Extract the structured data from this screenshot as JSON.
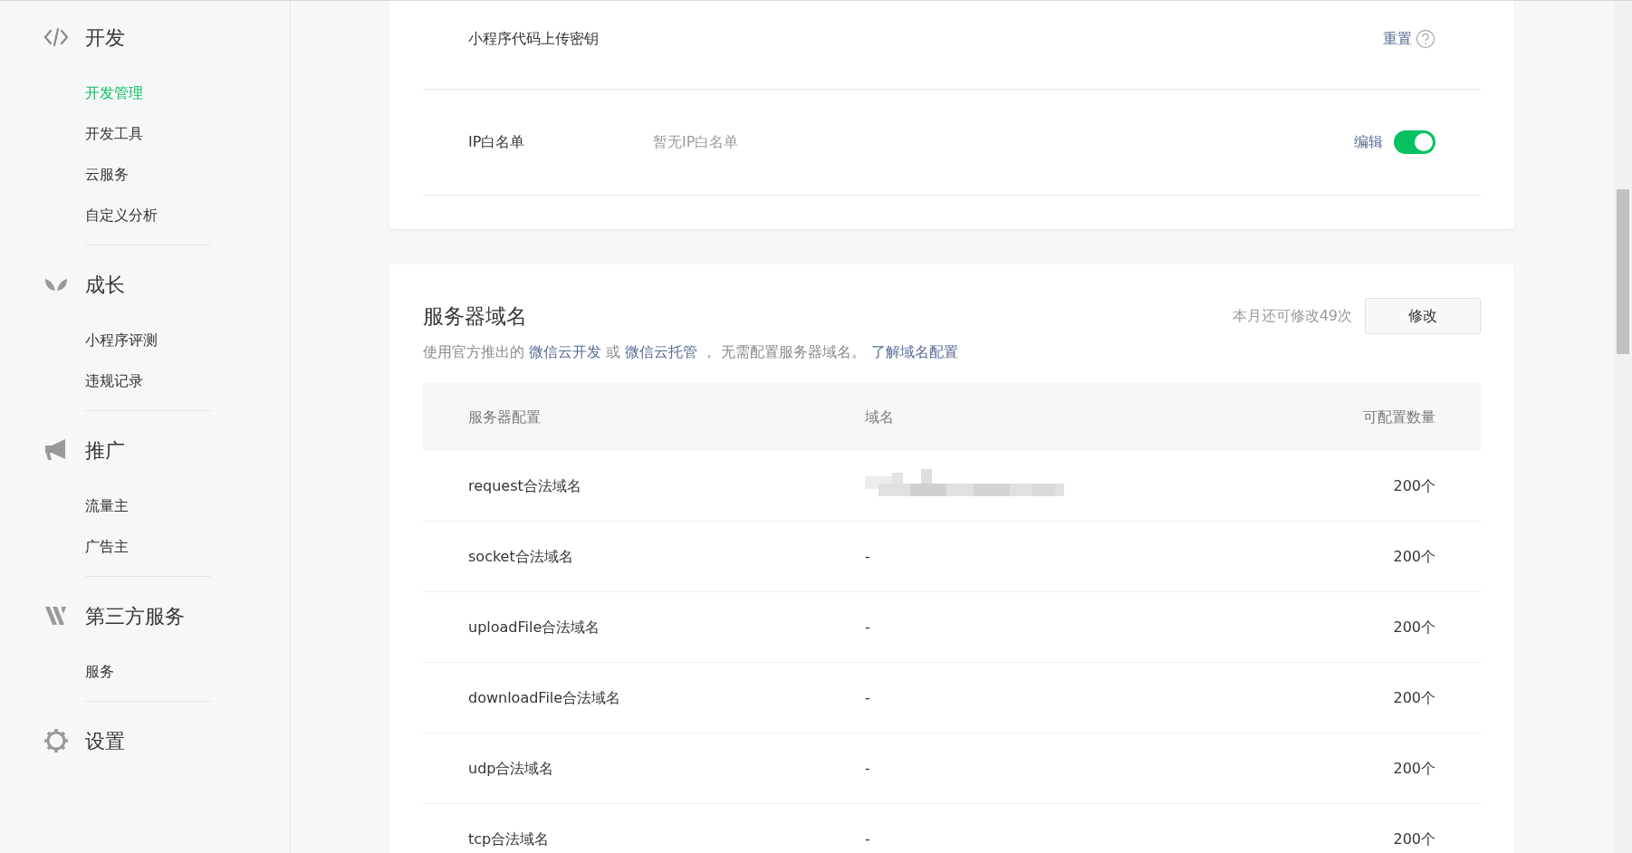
{
  "sidebar": {
    "groups": [
      {
        "title": "开发",
        "items": [
          {
            "label": "开发管理",
            "selected": true
          },
          {
            "label": "开发工具",
            "selected": false
          },
          {
            "label": "云服务",
            "selected": false
          },
          {
            "label": "自定义分析",
            "selected": false
          }
        ]
      },
      {
        "title": "成长",
        "items": [
          {
            "label": "小程序评测",
            "selected": false
          },
          {
            "label": "违规记录",
            "selected": false
          }
        ]
      },
      {
        "title": "推广",
        "items": [
          {
            "label": "流量主",
            "selected": false
          },
          {
            "label": "广告主",
            "selected": false
          }
        ]
      },
      {
        "title": "第三方服务",
        "items": [
          {
            "label": "服务",
            "selected": false
          }
        ]
      },
      {
        "title": "设置"
      }
    ]
  },
  "settings_rows": [
    {
      "label": "小程序代码上传密钥",
      "action": "重置",
      "help": true
    },
    {
      "label": "IP白名单",
      "value": "暂无IP白名单",
      "action": "编辑",
      "toggle": {
        "on": true
      }
    }
  ],
  "server_domain": {
    "title": "服务器域名",
    "remaining": "本月还可修改49次",
    "button": "修改",
    "description": [
      {
        "kind": "text",
        "text": "使用官方推出的 "
      },
      {
        "kind": "link",
        "text": "微信云开发"
      },
      {
        "kind": "text",
        "text": " 或 "
      },
      {
        "kind": "link",
        "text": "微信云托管"
      },
      {
        "kind": "text",
        "text": " ， 无需配置服务器域名。 "
      },
      {
        "kind": "link",
        "text": "了解域名配置"
      }
    ],
    "table": {
      "columns": [
        "服务器配置",
        "域名",
        "可配置数量"
      ],
      "rows": [
        {
          "config": "request合法域名",
          "domain_redacted": true,
          "count": "200个"
        },
        {
          "config": "socket合法域名",
          "domain": "-",
          "count": "200个"
        },
        {
          "config": "uploadFile合法域名",
          "domain": "-",
          "count": "200个"
        },
        {
          "config": "downloadFile合法域名",
          "domain": "-",
          "count": "200个"
        },
        {
          "config": "udp合法域名",
          "domain": "-",
          "count": "200个"
        },
        {
          "config": "tcp合法域名",
          "domain": "-",
          "count": "200个"
        }
      ]
    }
  }
}
